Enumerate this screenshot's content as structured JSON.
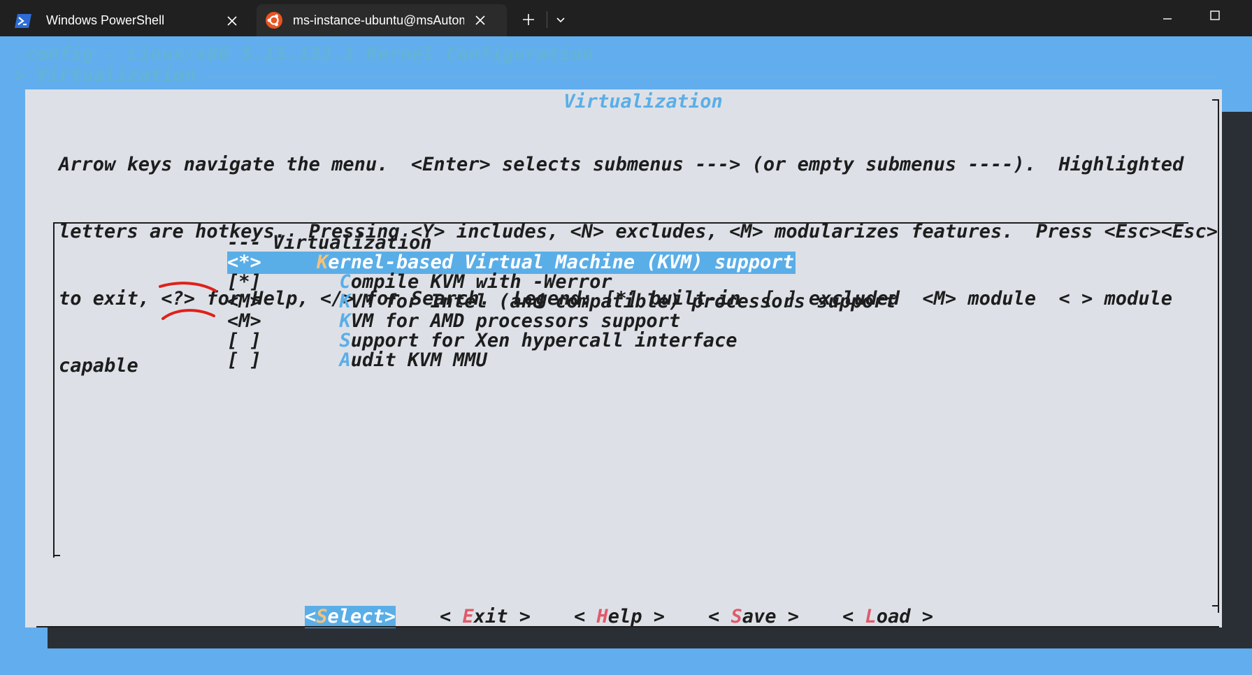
{
  "tabs": [
    {
      "label": "Windows PowerShell",
      "icon": "powershell-icon"
    },
    {
      "label": "ms-instance-ubuntu@msAutomation",
      "icon": "ubuntu-icon",
      "active": true
    }
  ],
  "terminal": {
    "bg_title": ".config - Linux/x86 5.15.133.1 Kernel Configuration",
    "bg_crumb": "> Virtualization",
    "dialog": {
      "title": "Virtualization",
      "help_lines": [
        "Arrow keys navigate the menu.  <Enter> selects submenus ---> (or empty submenus ----).  Highlighted",
        "letters are hotkeys.  Pressing <Y> includes, <N> excludes, <M> modularizes features.  Press <Esc><Esc>",
        "to exit, <?> for Help, </> for Search.  Legend: [*] built-in  [ ] excluded  <M> module  < > module",
        "capable"
      ],
      "menu_header": "--- Virtualization",
      "items": [
        {
          "mark": "<*>",
          "hotkey": "K",
          "rest": "ernel-based Virtual Machine (KVM) support",
          "selected": true,
          "indent": ""
        },
        {
          "mark": "[*]",
          "hotkey": "C",
          "rest": "ompile KVM with -Werror",
          "indent": "  "
        },
        {
          "mark": "<M>",
          "hotkey": "K",
          "rest": "VM for Intel (and compatible) processors support",
          "indent": "  "
        },
        {
          "mark": "<M>",
          "hotkey": "K",
          "rest": "VM for AMD processors support",
          "indent": "  "
        },
        {
          "mark": "[ ]",
          "hotkey": "S",
          "rest": "upport for Xen hypercall interface",
          "indent": "  "
        },
        {
          "mark": "[ ]",
          "hotkey": "A",
          "rest": "udit KVM MMU",
          "indent": "  "
        }
      ],
      "buttons": [
        {
          "pre": "<",
          "hotkey": "S",
          "rest": "elect>",
          "active": true
        },
        {
          "pre": "< ",
          "hotkey": "E",
          "rest": "xit >"
        },
        {
          "pre": "< ",
          "hotkey": "H",
          "rest": "elp >"
        },
        {
          "pre": "< ",
          "hotkey": "S",
          "rest": "ave >"
        },
        {
          "pre": "< ",
          "hotkey": "L",
          "rest": "oad >"
        }
      ]
    }
  },
  "colors": {
    "terminal_bg": "#62adee",
    "dialog_bg": "#dde1e7",
    "highlight": "#5aaee8",
    "hotkey_selected": "#f5c27a",
    "button_hotkey": "#e05a6a",
    "annotation": "#e0201a"
  }
}
